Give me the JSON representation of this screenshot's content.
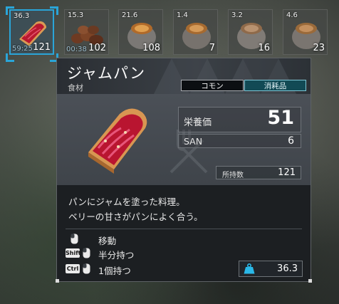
{
  "inventory": {
    "slots": [
      {
        "top": "36.3",
        "count": "121",
        "timer": "59:25",
        "icon": "jam-bread-icon"
      },
      {
        "top": "15.3",
        "count": "102",
        "timer": "00:38",
        "icon": "nuts-icon"
      },
      {
        "top": "21.6",
        "count": "108",
        "icon": "stone-pot-icon"
      },
      {
        "top": "1.4",
        "count": "7",
        "icon": "stone-pot-icon"
      },
      {
        "top": "3.2",
        "count": "16",
        "icon": "stone-pot-icon"
      },
      {
        "top": "4.6",
        "count": "23",
        "icon": "stone-pot-icon"
      }
    ]
  },
  "tooltip": {
    "name": "ジャムパン",
    "category": "食材",
    "tags": {
      "common": "コモン",
      "consumable": "消耗品"
    },
    "stats": {
      "nutrition_label": "栄養価",
      "nutrition_value": "51",
      "san_label": "SAN",
      "san_value": "6",
      "owned_label": "所持数",
      "owned_value": "121"
    },
    "description": [
      "パンにジャムを塗った料理。",
      "ベリーの甘さがパンによく合う。"
    ],
    "controls": [
      {
        "keys": [],
        "label": "移動"
      },
      {
        "keys": [
          "Shift"
        ],
        "label": "半分持つ"
      },
      {
        "keys": [
          "Ctrl"
        ],
        "label": "1個持つ"
      }
    ],
    "weight": "36.3"
  },
  "colors": {
    "selection": "#2aa5d8",
    "consumable_tag": "#124a55",
    "jam": "#c21a3c"
  }
}
